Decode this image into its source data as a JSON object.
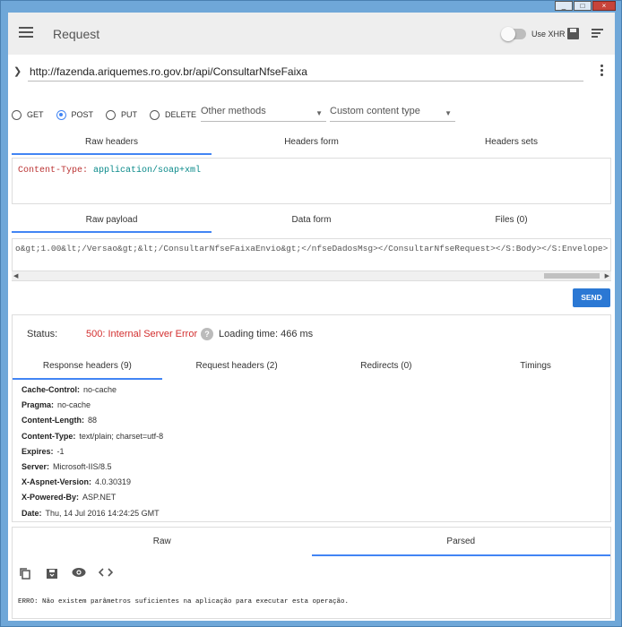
{
  "window": {
    "buttons": [
      "_",
      "□",
      "×"
    ]
  },
  "appbar": {
    "title": "Request",
    "xhr_label": "Use XHR"
  },
  "url": {
    "value": "http://fazenda.ariquemes.ro.gov.br/api/ConsultarNfseFaixa"
  },
  "methods": {
    "options": [
      "GET",
      "POST",
      "PUT",
      "DELETE"
    ],
    "selected": "POST",
    "other_placeholder": "Other methods",
    "content_type_placeholder": "Custom content type"
  },
  "header_tabs": [
    "Raw headers",
    "Headers form",
    "Headers sets"
  ],
  "raw_headers": {
    "key": "Content-Type:",
    "value": "application/soap+xml"
  },
  "payload_tabs": [
    "Raw payload",
    "Data form",
    "Files (0)"
  ],
  "payload": {
    "text": "o&gt;1.00&lt;/Versao&gt;&lt;/ConsultarNfseFaixaEnvio&gt;</nfseDadosMsg></ConsultarNfseRequest></S:Body></S:Envelope>"
  },
  "send_label": "SEND",
  "response": {
    "status_label": "Status:",
    "status_value": "500: Internal Server Error",
    "loading_text": "Loading time: 466 ms",
    "tabs": [
      "Response headers (9)",
      "Request headers (2)",
      "Redirects (0)",
      "Timings"
    ],
    "headers": [
      {
        "k": "Cache-Control:",
        "v": "no-cache"
      },
      {
        "k": "Pragma:",
        "v": "no-cache"
      },
      {
        "k": "Content-Length:",
        "v": "88"
      },
      {
        "k": "Content-Type:",
        "v": "text/plain; charset=utf-8"
      },
      {
        "k": "Expires:",
        "v": "-1"
      },
      {
        "k": "Server:",
        "v": "Microsoft-IIS/8.5"
      },
      {
        "k": "X-Aspnet-Version:",
        "v": "4.0.30319"
      },
      {
        "k": "X-Powered-By:",
        "v": "ASP.NET"
      },
      {
        "k": "Date:",
        "v": "Thu, 14 Jul 2016 14:24:25 GMT"
      }
    ]
  },
  "body": {
    "tabs": [
      "Raw",
      "Parsed"
    ],
    "error_text": "ERRO: Não existem parâmetros suficientes na aplicação para executar esta operação."
  },
  "icons": {
    "copy": "copy-icon",
    "save": "save-response-icon",
    "preview": "eye-icon",
    "code": "code-icon"
  }
}
